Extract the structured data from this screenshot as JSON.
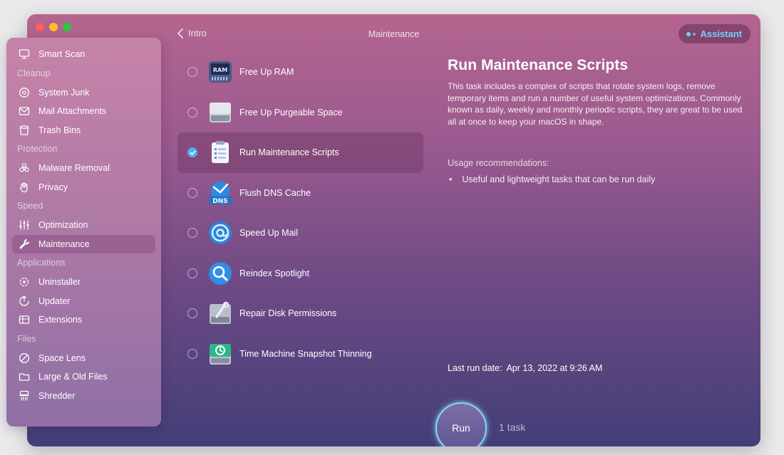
{
  "window": {
    "title": "Maintenance",
    "back_label": "Intro",
    "assistant_label": "Assistant",
    "accent_color": "#6fd3ff"
  },
  "sidebar": {
    "top": {
      "label": "Smart Scan",
      "icon": "monitor-icon"
    },
    "sections": [
      {
        "title": "Cleanup",
        "items": [
          {
            "label": "System Junk",
            "icon": "cleanup-disc-icon"
          },
          {
            "label": "Mail Attachments",
            "icon": "mail-icon"
          },
          {
            "label": "Trash Bins",
            "icon": "trash-icon"
          }
        ]
      },
      {
        "title": "Protection",
        "items": [
          {
            "label": "Malware Removal",
            "icon": "biohazard-icon"
          },
          {
            "label": "Privacy",
            "icon": "hand-icon"
          }
        ]
      },
      {
        "title": "Speed",
        "items": [
          {
            "label": "Optimization",
            "icon": "sliders-icon"
          },
          {
            "label": "Maintenance",
            "icon": "wrench-icon",
            "active": true
          }
        ]
      },
      {
        "title": "Applications",
        "items": [
          {
            "label": "Uninstaller",
            "icon": "uninstaller-icon"
          },
          {
            "label": "Updater",
            "icon": "updater-icon"
          },
          {
            "label": "Extensions",
            "icon": "extensions-icon"
          }
        ]
      },
      {
        "title": "Files",
        "items": [
          {
            "label": "Space Lens",
            "icon": "space-lens-icon"
          },
          {
            "label": "Large & Old Files",
            "icon": "folder-icon"
          },
          {
            "label": "Shredder",
            "icon": "shredder-icon"
          }
        ]
      }
    ]
  },
  "tasks": [
    {
      "label": "Free Up RAM",
      "icon": "ram-chip-icon",
      "checked": false
    },
    {
      "label": "Free Up Purgeable Space",
      "icon": "drive-icon",
      "checked": false
    },
    {
      "label": "Run Maintenance Scripts",
      "icon": "clipboard-icon",
      "checked": true
    },
    {
      "label": "Flush DNS Cache",
      "icon": "dns-icon",
      "checked": false
    },
    {
      "label": "Speed Up Mail",
      "icon": "mail-at-icon",
      "checked": false
    },
    {
      "label": "Reindex Spotlight",
      "icon": "spotlight-icon",
      "checked": false
    },
    {
      "label": "Repair Disk Permissions",
      "icon": "disk-wrench-icon",
      "checked": false
    },
    {
      "label": "Time Machine Snapshot Thinning",
      "icon": "time-machine-icon",
      "checked": false
    }
  ],
  "ram_chip_text": "RAM",
  "dns_text": "DNS",
  "detail": {
    "title": "Run Maintenance Scripts",
    "description": "This task includes a complex of scripts that rotate system logs, remove temporary items and run a number of useful system optimizations. Commonly known as daily, weekly and monthly periodic scripts, they are great to be used all at once to keep your macOS in shape.",
    "usage_title": "Usage recommendations:",
    "usage_bullet": "•",
    "usage_item": "Useful and lightweight tasks that can be run daily",
    "last_run_label": "Last run date:",
    "last_run_value": "Apr 13, 2022 at 9:26 AM"
  },
  "run": {
    "label": "Run",
    "task_count": "1 task"
  }
}
